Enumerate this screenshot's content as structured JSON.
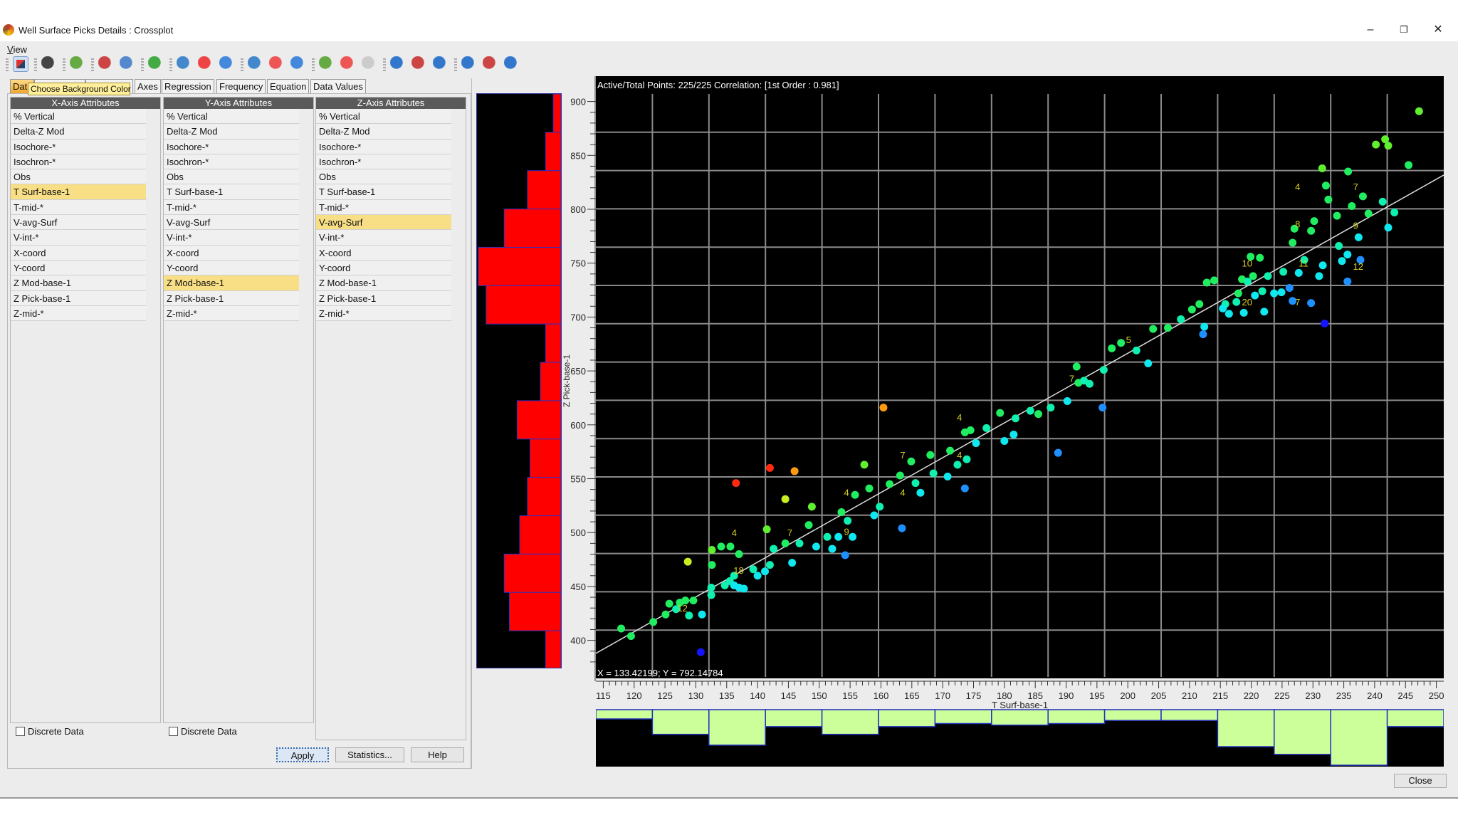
{
  "window": {
    "title": "Well Surface Picks Details : Crossplot",
    "controls": [
      "minimize",
      "restore",
      "close"
    ]
  },
  "menu": {
    "view_prefix": "V",
    "view_rest": "iew"
  },
  "toolbar": {
    "icons": [
      "background-color-icon",
      "frame-icon",
      "properties-icon",
      "zoom-box-icon",
      "zoom-icon",
      "grid-icon",
      "pencil-icon",
      "point-red-icon",
      "points-icon",
      "edit-icon",
      "add-point-icon",
      "multi-point-icon",
      "line-icon",
      "line-delete-icon",
      "line-disabled-icon",
      "expand-h-icon",
      "delete-h-icon",
      "fit-h-icon",
      "expand-v-icon",
      "delete-v-icon",
      "fit-v-icon"
    ]
  },
  "tabs": {
    "data": "Dat",
    "axes": "Axes",
    "regression": "Regression",
    "frequency": "Frequency",
    "equation": "Equation",
    "data_values": "Data Values"
  },
  "tooltip": "Choose Background Color",
  "columns": [
    {
      "header": "X-Axis Attributes",
      "selected": 5,
      "discrete_label": "Discrete Data"
    },
    {
      "header": "Y-Axis Attributes",
      "selected": 11,
      "discrete_label": "Discrete Data"
    },
    {
      "header": "Z-Axis Attributes",
      "selected": 7
    }
  ],
  "attributes": [
    "% Vertical",
    "Delta-Z Mod",
    "Isochore-*",
    "Isochron-*",
    "Obs",
    "T Surf-base-1",
    "T-mid-*",
    "V-avg-Surf",
    "V-int-*",
    "X-coord",
    "Y-coord",
    "Z Mod-base-1",
    "Z Pick-base-1",
    "Z-mid-*"
  ],
  "buttons": {
    "apply": "Apply",
    "statistics": "Statistics...",
    "help": "Help",
    "close": "Close"
  },
  "colors": {
    "histogram_y": "#ff0000",
    "histogram_x": "#ccff99",
    "plot_bg": "#000000",
    "z_levels": [
      "#1414ff",
      "#1e90ff",
      "#10e8f0",
      "#10f0b0",
      "#20ee60",
      "#60f030",
      "#c8f020",
      "#ff9a10",
      "#ff2a10"
    ]
  },
  "chart_data": {
    "type": "scatter",
    "header": "Active/Total Points: 225/225  Correlation:  [1st Order : 0.981]",
    "cursor_readout": "X = 133.42199; Y = 792.14784",
    "xlabel": "T Surf-base-1",
    "ylabel": "Z Pick-base-1",
    "xlim": [
      113.8,
      251.2
    ],
    "ylim": [
      374,
      907
    ],
    "xticks": [
      115,
      120,
      125,
      130,
      135,
      140,
      145,
      150,
      155,
      160,
      165,
      170,
      175,
      180,
      185,
      190,
      195,
      200,
      205,
      210,
      215,
      220,
      225,
      230,
      235,
      240,
      245,
      250
    ],
    "yticks": [
      400,
      450,
      500,
      550,
      600,
      650,
      700,
      750,
      800,
      850,
      900
    ],
    "regression": {
      "slope": 3.23,
      "intercept": 20.4
    },
    "points": [
      [
        117.9,
        411,
        4
      ],
      [
        119.5,
        404,
        4
      ],
      [
        123.1,
        417,
        4
      ],
      [
        125.1,
        424,
        4
      ],
      [
        125.7,
        434,
        4
      ],
      [
        127.4,
        435,
        4
      ],
      [
        126.8,
        429,
        3
      ],
      [
        128.3,
        437,
        4
      ],
      [
        129.6,
        437,
        4
      ],
      [
        128.9,
        423,
        3
      ],
      [
        131.0,
        424,
        2
      ],
      [
        130.8,
        389,
        0
      ],
      [
        128.7,
        473,
        6
      ],
      [
        132.5,
        449,
        3
      ],
      [
        132.5,
        442,
        3
      ],
      [
        132.6,
        470,
        4
      ],
      [
        132.6,
        484,
        5
      ],
      [
        134.1,
        487,
        4
      ],
      [
        135.6,
        487,
        4
      ],
      [
        137.0,
        480,
        4
      ],
      [
        136.5,
        546,
        8
      ],
      [
        134.7,
        451,
        3
      ],
      [
        135.5,
        455,
        3
      ],
      [
        136.2,
        451,
        2
      ],
      [
        137.0,
        449,
        2
      ],
      [
        137.8,
        448,
        2
      ],
      [
        136.2,
        460,
        3
      ],
      [
        139.3,
        466,
        3
      ],
      [
        140.0,
        460,
        2
      ],
      [
        141.2,
        464,
        2
      ],
      [
        142.0,
        470,
        3
      ],
      [
        141.5,
        503,
        5
      ],
      [
        142.6,
        485,
        3
      ],
      [
        142.0,
        560,
        8
      ],
      [
        144.5,
        531,
        6
      ],
      [
        146.0,
        557,
        7
      ],
      [
        145.6,
        472,
        2
      ],
      [
        144.5,
        490,
        4
      ],
      [
        146.8,
        490,
        3
      ],
      [
        148.8,
        524,
        5
      ],
      [
        148.3,
        507,
        4
      ],
      [
        149.5,
        487,
        2
      ],
      [
        151.3,
        496,
        3
      ],
      [
        152.1,
        485,
        2
      ],
      [
        153.1,
        496,
        2
      ],
      [
        153.6,
        519,
        4
      ],
      [
        154.2,
        479,
        1
      ],
      [
        155.4,
        496,
        2
      ],
      [
        154.6,
        511,
        3
      ],
      [
        155.8,
        535,
        4
      ],
      [
        157.3,
        563,
        5
      ],
      [
        158.1,
        541,
        4
      ],
      [
        158.9,
        516,
        2
      ],
      [
        159.8,
        524,
        3
      ],
      [
        160.4,
        616,
        7
      ],
      [
        161.4,
        545,
        4
      ],
      [
        163.1,
        553,
        4
      ],
      [
        163.4,
        504,
        1
      ],
      [
        164.9,
        566,
        4
      ],
      [
        165.6,
        546,
        3
      ],
      [
        166.4,
        537,
        2
      ],
      [
        168.0,
        572,
        4
      ],
      [
        168.5,
        555,
        3
      ],
      [
        170.8,
        552,
        2
      ],
      [
        171.2,
        576,
        4
      ],
      [
        172.4,
        563,
        3
      ],
      [
        173.6,
        541,
        1
      ],
      [
        173.9,
        568,
        3
      ],
      [
        173.6,
        593,
        4
      ],
      [
        174.5,
        595,
        4
      ],
      [
        175.4,
        583,
        2
      ],
      [
        177.1,
        597,
        3
      ],
      [
        179.3,
        611,
        4
      ],
      [
        180.0,
        585,
        2
      ],
      [
        181.5,
        591,
        2
      ],
      [
        181.8,
        606,
        3
      ],
      [
        184.2,
        613,
        3
      ],
      [
        185.5,
        610,
        4
      ],
      [
        187.5,
        616,
        3
      ],
      [
        188.7,
        574,
        1
      ],
      [
        190.2,
        622,
        2
      ],
      [
        191.7,
        654,
        4
      ],
      [
        192.0,
        639,
        4
      ],
      [
        192.9,
        641,
        3
      ],
      [
        193.8,
        638,
        3
      ],
      [
        195.9,
        616,
        1
      ],
      [
        196.1,
        651,
        3
      ],
      [
        197.4,
        671,
        4
      ],
      [
        198.9,
        676,
        4
      ],
      [
        201.4,
        669,
        3
      ],
      [
        203.3,
        657,
        2
      ],
      [
        204.1,
        689,
        4
      ],
      [
        206.5,
        690,
        4
      ],
      [
        208.6,
        698,
        3
      ],
      [
        210.4,
        707,
        4
      ],
      [
        211.6,
        712,
        4
      ],
      [
        212.4,
        691,
        2
      ],
      [
        212.2,
        684,
        1
      ],
      [
        212.8,
        732,
        4
      ],
      [
        214.0,
        734,
        4
      ],
      [
        215.8,
        712,
        3
      ],
      [
        216.4,
        703,
        2
      ],
      [
        215.4,
        708,
        2
      ],
      [
        217.6,
        714,
        3
      ],
      [
        217.9,
        722,
        4
      ],
      [
        218.5,
        735,
        4
      ],
      [
        219.4,
        733,
        3
      ],
      [
        220.3,
        738,
        4
      ],
      [
        219.9,
        756,
        4
      ],
      [
        221.4,
        755,
        4
      ],
      [
        218.8,
        704,
        2
      ],
      [
        220.6,
        720,
        2
      ],
      [
        221.8,
        724,
        3
      ],
      [
        222.1,
        705,
        2
      ],
      [
        222.7,
        738,
        3
      ],
      [
        223.7,
        722,
        2
      ],
      [
        224.9,
        723,
        2
      ],
      [
        225.2,
        742,
        3
      ],
      [
        226.2,
        727,
        1
      ],
      [
        226.7,
        715,
        1
      ],
      [
        226.7,
        769,
        4
      ],
      [
        227.0,
        782,
        4
      ],
      [
        227.7,
        741,
        2
      ],
      [
        228.6,
        753,
        3
      ],
      [
        229.7,
        713,
        1
      ],
      [
        229.7,
        780,
        4
      ],
      [
        230.2,
        789,
        4
      ],
      [
        231.0,
        738,
        2
      ],
      [
        231.6,
        748,
        2
      ],
      [
        231.9,
        694,
        0
      ],
      [
        231.5,
        838,
        5
      ],
      [
        232.1,
        822,
        4
      ],
      [
        232.5,
        809,
        4
      ],
      [
        233.9,
        794,
        4
      ],
      [
        234.2,
        766,
        3
      ],
      [
        234.7,
        752,
        2
      ],
      [
        235.6,
        733,
        1
      ],
      [
        235.7,
        835,
        4
      ],
      [
        235.6,
        758,
        2
      ],
      [
        236.3,
        803,
        4
      ],
      [
        237.4,
        774,
        2
      ],
      [
        237.7,
        753,
        1
      ],
      [
        238.1,
        812,
        4
      ],
      [
        239.0,
        796,
        4
      ],
      [
        240.2,
        860,
        5
      ],
      [
        241.3,
        807,
        3
      ],
      [
        242.2,
        859,
        5
      ],
      [
        241.7,
        865,
        5
      ],
      [
        242.2,
        783,
        2
      ],
      [
        243.2,
        797,
        3
      ],
      [
        245.5,
        841,
        4
      ],
      [
        247.2,
        891,
        5
      ]
    ],
    "count_labels": [
      {
        "text": "12",
        "x": 127.0,
        "y": 427
      },
      {
        "text": "18",
        "x": 136.1,
        "y": 462
      },
      {
        "text": "4",
        "x": 135.8,
        "y": 497
      },
      {
        "text": "7",
        "x": 144.8,
        "y": 497
      },
      {
        "text": "4",
        "x": 154.0,
        "y": 534
      },
      {
        "text": "9",
        "x": 154.0,
        "y": 498
      },
      {
        "text": "4",
        "x": 163.1,
        "y": 534
      },
      {
        "text": "7",
        "x": 163.1,
        "y": 569
      },
      {
        "text": "4",
        "x": 172.3,
        "y": 569
      },
      {
        "text": "4",
        "x": 172.3,
        "y": 604
      },
      {
        "text": "7",
        "x": 190.5,
        "y": 640
      },
      {
        "text": "5",
        "x": 199.7,
        "y": 676
      },
      {
        "text": "10",
        "x": 218.5,
        "y": 747
      },
      {
        "text": "20",
        "x": 218.5,
        "y": 711
      },
      {
        "text": "11",
        "x": 227.7,
        "y": 747
      },
      {
        "text": "7",
        "x": 227.1,
        "y": 711
      },
      {
        "text": "12",
        "x": 236.5,
        "y": 744
      },
      {
        "text": "8",
        "x": 227.1,
        "y": 783
      },
      {
        "text": "4",
        "x": 227.1,
        "y": 818
      },
      {
        "text": "7",
        "x": 236.5,
        "y": 818
      },
      {
        "text": "9",
        "x": 236.5,
        "y": 782
      }
    ],
    "x_histogram": {
      "bins": 15,
      "counts": [
        6,
        16,
        23,
        11,
        16,
        11,
        9,
        10,
        9,
        7,
        7,
        24,
        29,
        36,
        11
      ]
    },
    "y_histogram": {
      "bins": 15,
      "counts_top_to_bottom": [
        3,
        6,
        13,
        22,
        32,
        29,
        6,
        8,
        17,
        12,
        13,
        16,
        22,
        20,
        6
      ]
    }
  }
}
